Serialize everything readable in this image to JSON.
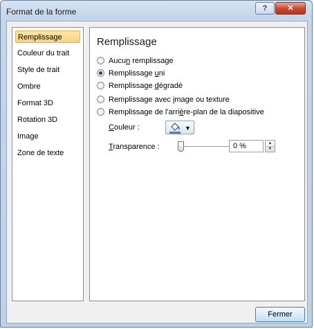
{
  "window": {
    "title": "Format de la forme",
    "help_glyph": "?",
    "close_glyph": "✕"
  },
  "nav": {
    "selected": 0,
    "items": [
      {
        "label": "Remplissage"
      },
      {
        "label": "Couleur du trait"
      },
      {
        "label": "Style de trait"
      },
      {
        "label": "Ombre"
      },
      {
        "label": "Format 3D"
      },
      {
        "label": "Rotation 3D"
      },
      {
        "label": "Image"
      },
      {
        "label": "Zone de texte"
      }
    ]
  },
  "panel": {
    "title": "Remplissage",
    "options": [
      {
        "pre": "Aucu",
        "u": "n",
        "post": " remplissage",
        "checked": false
      },
      {
        "pre": "Remplissage ",
        "u": "u",
        "post": "ni",
        "checked": true
      },
      {
        "pre": "Remplissage ",
        "u": "d",
        "post": "égradé",
        "checked": false
      },
      {
        "pre": "Remplissage avec ",
        "u": "i",
        "post": "mage ou texture",
        "checked": false
      },
      {
        "pre": "Remplissage de l'arri",
        "u": "è",
        "post": "re-plan de la diapositive",
        "checked": false
      }
    ],
    "color": {
      "label_u": "C",
      "label_rest": "ouleur :",
      "swatch": "#4f81bd",
      "bucket_icon": "paint-bucket-icon",
      "caret": "▼"
    },
    "transparency": {
      "label_u": "T",
      "label_rest": "ransparence :",
      "value": "0 %",
      "level": 0
    }
  },
  "footer": {
    "close_label": "Fermer"
  }
}
